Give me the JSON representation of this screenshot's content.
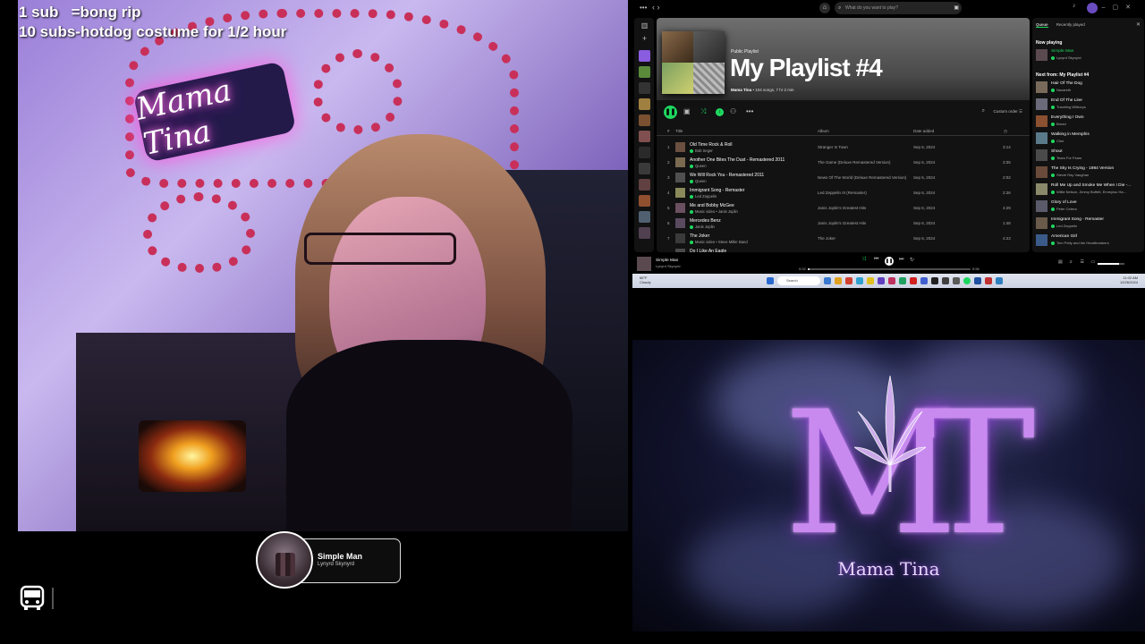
{
  "stream_overlay": {
    "goal_line_1": "1 sub   =bong rip",
    "goal_line_2": "10 subs-hotdog costume for 1/2 hour",
    "neon_sign": "Mama Tina",
    "now_playing": {
      "title": "Simple Man",
      "artist": "Lynyrd Skynyrd"
    },
    "bottom_icon": "bus-icon"
  },
  "spotify": {
    "search_placeholder": "What do you want to play?",
    "playlist": {
      "type": "Public Playlist",
      "title": "My Playlist #4",
      "owner": "Mama Tina",
      "meta": " • 104 songs, 7 hr 2 min",
      "sort_label": "Custom order"
    },
    "columns": {
      "num": "#",
      "title": "Title",
      "album": "Album",
      "date": "Date added"
    },
    "tracks": [
      {
        "num": "1",
        "title": "Old Time Rock & Roll",
        "artist": "Bob Seger",
        "album": "Stranger In Town",
        "date": "Sep 6, 2024",
        "duration": "3:14"
      },
      {
        "num": "2",
        "title": "Another One Bites The Dust - Remastered 2011",
        "artist": "Queen",
        "album": "The Game (Deluxe Remastered Version)",
        "date": "Sep 6, 2024",
        "duration": "3:35"
      },
      {
        "num": "3",
        "title": "We Will Rock You - Remastered 2011",
        "artist": "Queen",
        "album": "News Of The World (Deluxe Remastered Version)",
        "date": "Sep 6, 2024",
        "duration": "2:02"
      },
      {
        "num": "4",
        "title": "Immigrant Song - Remaster",
        "artist": "Led Zeppelin",
        "album": "Led Zeppelin III (Remaster)",
        "date": "Sep 6, 2024",
        "duration": "2:26"
      },
      {
        "num": "5",
        "title": "Me and Bobby McGee",
        "artist": "Music video • Janis Joplin",
        "album": "Janis Joplin's Greatest Hits",
        "date": "Sep 6, 2024",
        "duration": "4:29"
      },
      {
        "num": "6",
        "title": "Mercedes Benz",
        "artist": "Janis Joplin",
        "album": "Janis Joplin's Greatest Hits",
        "date": "Sep 6, 2024",
        "duration": "1:48"
      },
      {
        "num": "7",
        "title": "The Joker",
        "artist": "Music video • Steve Miller Band",
        "album": "The Joker",
        "date": "Sep 6, 2024",
        "duration": "4:23"
      },
      {
        "num": "8",
        "title": "Do I Like An Eagle",
        "artist": "",
        "album": "",
        "date": "",
        "duration": ""
      }
    ],
    "queue": {
      "tab_queue": "Queue",
      "tab_recent": "Recently played",
      "now_playing_label": "Now playing",
      "now_playing": {
        "title": "Simple Man",
        "artist": "Lynyrd Skynyrd"
      },
      "next_label": "Next from: My Playlist #4",
      "items": [
        {
          "title": "Hair Of The Dog",
          "artist": "Nazareth"
        },
        {
          "title": "End Of The Line",
          "artist": "Traveling Wilburys"
        },
        {
          "title": "Everything I Own",
          "artist": "Bread"
        },
        {
          "title": "Walking in Memphis",
          "artist": "Cher"
        },
        {
          "title": "Shout",
          "artist": "Tears For Fears"
        },
        {
          "title": "The Sky Is Crying - 1984 Version",
          "artist": "Stevie Ray Vaughan"
        },
        {
          "title": "Roll Me Up and Smoke Me When I Die -...",
          "artist": "Willie Nelson, Jimmy Buffett, Emmylou Ha..."
        },
        {
          "title": "Glory of Love",
          "artist": "Peter Cetera"
        },
        {
          "title": "Immigrant Song - Remaster",
          "artist": "Led Zeppelin"
        },
        {
          "title": "American Girl",
          "artist": "Tom Petty and the Heartbreakers"
        }
      ]
    },
    "player": {
      "title": "Simple Man",
      "artist": "Lynyrd Skynyrd",
      "elapsed": "0:02",
      "total": "5:56",
      "progress": 0.01,
      "volume": 0.8
    }
  },
  "taskbar": {
    "weather_temp": "66°F",
    "weather_desc": "Cloudy",
    "search_label": "Search",
    "time": "11:02 AM",
    "date": "12/26/2024"
  },
  "logo": {
    "monogram": "MT",
    "name": "Mama Tina"
  },
  "colors": {
    "spotify_green": "#1ed760",
    "logo_purple": "#c98af0"
  }
}
